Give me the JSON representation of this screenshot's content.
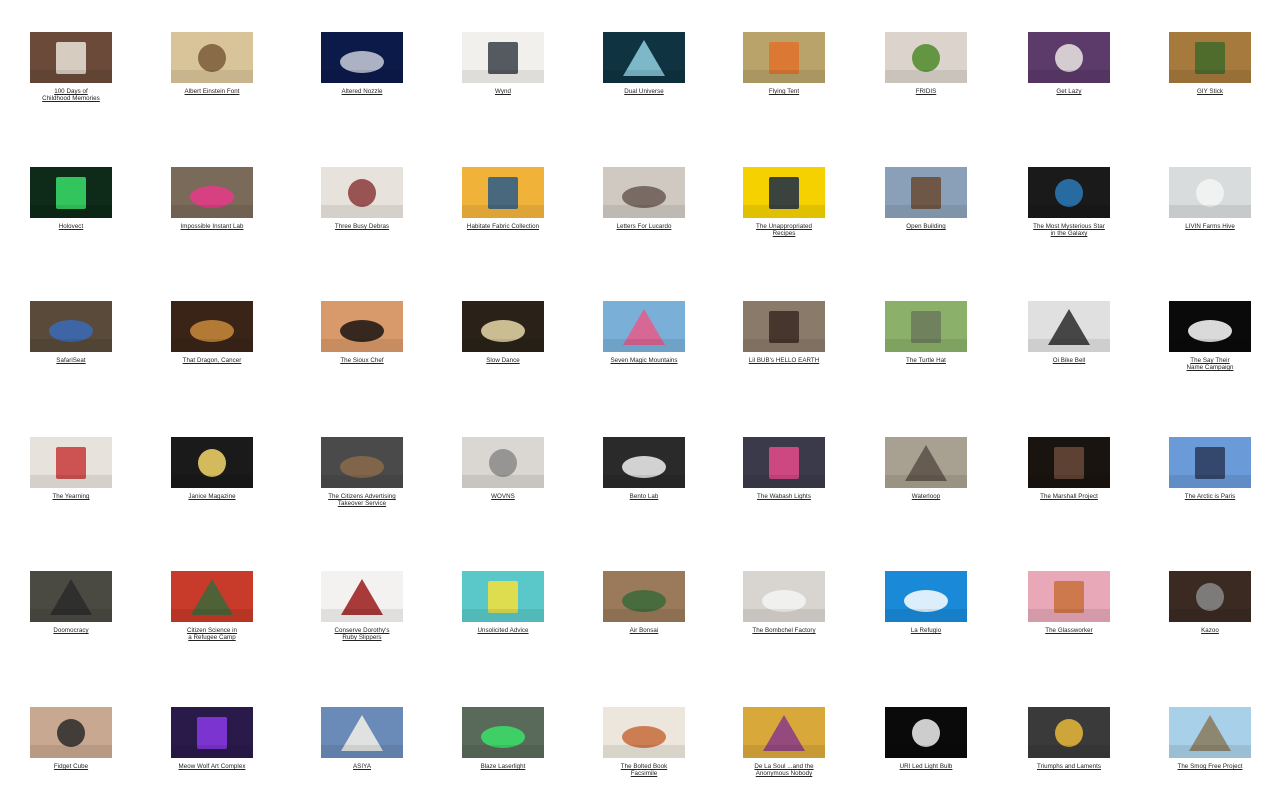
{
  "projects": [
    {
      "title": "100 Days of\nChildhood Memories",
      "bg": "#6b4a3a",
      "fg": "#e9e3d8",
      "icon": "memory-books-icon"
    },
    {
      "title": "Albert Einstein Font",
      "bg": "#d9c49a",
      "fg": "#7a5c38",
      "icon": "handwriting-icon"
    },
    {
      "title": "Altered Nozzle",
      "bg": "#0c1a4a",
      "fg": "#c9ced8",
      "icon": "faucet-icon"
    },
    {
      "title": "Wynd",
      "bg": "#f2f0ec",
      "fg": "#3a3f48",
      "icon": "air-purifier-icon"
    },
    {
      "title": "Dual Universe",
      "bg": "#0f3340",
      "fg": "#8fd0e0",
      "icon": "space-station-icon"
    },
    {
      "title": "Flying Tent",
      "bg": "#b9a36a",
      "fg": "#e0712a",
      "icon": "tent-icon"
    },
    {
      "title": "FRIDIS",
      "bg": "#dcd4cc",
      "fg": "#4f8a2a",
      "icon": "lime-figure-icon"
    },
    {
      "title": "Get Lazy",
      "bg": "#5c3a6a",
      "fg": "#e9e6e2",
      "icon": "phone-stand-icon"
    },
    {
      "title": "GIY Stick",
      "bg": "#a57a3c",
      "fg": "#3f6a2a",
      "icon": "potted-plant-icon"
    },
    {
      "title": "Holovect",
      "bg": "#0e2a18",
      "fg": "#39e06a",
      "icon": "hologram-icon"
    },
    {
      "title": "Impossible Instant Lab",
      "bg": "#7a6a5a",
      "fg": "#e73a8a",
      "icon": "instant-camera-icon"
    },
    {
      "title": "Three Busy Debras",
      "bg": "#e8e2dc",
      "fg": "#8a3a3a",
      "icon": "three-women-icon"
    },
    {
      "title": "Habitate Fabric Collection",
      "bg": "#f1b23a",
      "fg": "#2a5a8a",
      "icon": "geometric-fabric-icon"
    },
    {
      "title": "Letters For Lucardo",
      "bg": "#cfc9c2",
      "fg": "#6a5a52",
      "icon": "elderly-couple-icon"
    },
    {
      "title": "The Unappropriated\nRecipes",
      "bg": "#f5d100",
      "fg": "#1a2a4a",
      "icon": "cookbook-icon"
    },
    {
      "title": "Open Building",
      "bg": "#8aa0b8",
      "fg": "#6a4a32",
      "icon": "building-icon"
    },
    {
      "title": "The Most Mysterious Star\nin the Galaxy",
      "bg": "#1a1a1a",
      "fg": "#2a7ab8",
      "icon": "eye-icon"
    },
    {
      "title": "LIVIN Farms Hive",
      "bg": "#d8dcdc",
      "fg": "#f4f4f4",
      "icon": "hive-device-icon"
    },
    {
      "title": "SafariSeat",
      "bg": "#5a4a3a",
      "fg": "#3a6ab8",
      "icon": "wheelchair-icon"
    },
    {
      "title": "That Dragon, Cancer",
      "bg": "#3a2418",
      "fg": "#c88a3a",
      "icon": "game-scene-icon"
    },
    {
      "title": "The Sioux Chef",
      "bg": "#d89a6a",
      "fg": "#1a1410",
      "icon": "silhouette-icon"
    },
    {
      "title": "Slow Dance",
      "bg": "#2a2218",
      "fg": "#e8d8a8",
      "icon": "frame-lamp-icon"
    },
    {
      "title": "Seven Magic Mountains",
      "bg": "#7ab0d8",
      "fg": "#e85a8a",
      "icon": "stacked-rocks-icon"
    },
    {
      "title": "Lil BUB's HELLO EARTH",
      "bg": "#8a7a6a",
      "fg": "#3a2a22",
      "icon": "cat-face-icon"
    },
    {
      "title": "The Turtle Hat",
      "bg": "#8ab06a",
      "fg": "#6a7a5a",
      "icon": "knit-hat-icon"
    },
    {
      "title": "Oi Bike Bell",
      "bg": "#e0e0e0",
      "fg": "#2a2a2a",
      "icon": "bike-bell-icon"
    },
    {
      "title": "The Say Their\nName Campaign",
      "bg": "#0a0a0a",
      "fg": "#ffffff",
      "icon": "say-their-name-icon"
    },
    {
      "title": "The Yearning",
      "bg": "#e8e2dc",
      "fg": "#c83a3a",
      "icon": "illustration-icon"
    },
    {
      "title": "Janice Magazine",
      "bg": "#1a1a1a",
      "fg": "#f5d86a",
      "icon": "pop-art-icon"
    },
    {
      "title": "The Citizens Advertising\nTakeover Service",
      "bg": "#4a4a4a",
      "fg": "#8a6a4a",
      "icon": "subway-cat-icon"
    },
    {
      "title": "WOVNS",
      "bg": "#dad6d2",
      "fg": "#8a8a8a",
      "icon": "pattern-icon"
    },
    {
      "title": "Bento Lab",
      "bg": "#2a2a2a",
      "fg": "#f0f0f0",
      "icon": "lab-device-icon"
    },
    {
      "title": "The Wabash Lights",
      "bg": "#3a3a4a",
      "fg": "#e84a8a",
      "icon": "light-tunnel-icon"
    },
    {
      "title": "Waterloop",
      "bg": "#a8a090",
      "fg": "#5a5048",
      "icon": "cityscape-icon"
    },
    {
      "title": "The Marshall Project",
      "bg": "#1a1410",
      "fg": "#6a4a3a",
      "icon": "portrait-icon"
    },
    {
      "title": "The Arctic is Paris",
      "bg": "#6a9ad8",
      "fg": "#2a3a5a",
      "icon": "eiffel-tower-icon"
    },
    {
      "title": "Doomocracy",
      "bg": "#4a4a42",
      "fg": "#2a2a2a",
      "icon": "person-street-icon"
    },
    {
      "title": "Citizen Science in\na Refugee Camp",
      "bg": "#c83a2a",
      "fg": "#3a6a3a",
      "icon": "mural-icon"
    },
    {
      "title": "Conserve Dorothy's\nRuby Slippers",
      "bg": "#f4f2f0",
      "fg": "#9a1a1a",
      "icon": "ruby-slippers-icon"
    },
    {
      "title": "Unsolicited Advice",
      "bg": "#5ac8c8",
      "fg": "#f5e03a",
      "icon": "notebook-icon"
    },
    {
      "title": "Air Bonsai",
      "bg": "#9a7a5a",
      "fg": "#3a6a3a",
      "icon": "bonsai-icon"
    },
    {
      "title": "The Bombchel Factory",
      "bg": "#d8d4d0",
      "fg": "#f4f4f4",
      "icon": "tshirt-icon"
    },
    {
      "title": "La Refugio",
      "bg": "#1a8ad8",
      "fg": "#ffffff",
      "icon": "mascot-icon"
    },
    {
      "title": "The Glassworker",
      "bg": "#e8a8b8",
      "fg": "#c8703a",
      "icon": "anime-characters-icon"
    },
    {
      "title": "Kazoo",
      "bg": "#3a2a22",
      "fg": "#8a8a8a",
      "icon": "goggles-icon"
    },
    {
      "title": "Fidget Cube",
      "bg": "#c8a890",
      "fg": "#2a2a2a",
      "icon": "fidget-cube-icon"
    },
    {
      "title": "Meow Wolf Art Complex",
      "bg": "#2a1a4a",
      "fg": "#8a3ae8",
      "icon": "art-installation-icon"
    },
    {
      "title": "ASIYA",
      "bg": "#6a8ab8",
      "fg": "#f4f0e8",
      "icon": "two-women-icon"
    },
    {
      "title": "Blaze Laserlight",
      "bg": "#5a6a5a",
      "fg": "#39e06a",
      "icon": "bike-light-icon"
    },
    {
      "title": "The Bolted Book\nFacsimile",
      "bg": "#ece6dc",
      "fg": "#c86a3a",
      "icon": "exhibition-icon"
    },
    {
      "title": "De La Soul ...and the\nAnonymous Nobody",
      "bg": "#d8a83a",
      "fg": "#8a3a8a",
      "icon": "album-art-icon"
    },
    {
      "title": "URI Led Light Bulb",
      "bg": "#0a0a0a",
      "fg": "#f0f0f0",
      "icon": "light-bulbs-icon"
    },
    {
      "title": "Triumphs and Laments",
      "bg": "#3a3a3a",
      "fg": "#e8b83a",
      "icon": "yellow-line-icon"
    },
    {
      "title": "The Smog Free Project",
      "bg": "#a8d0e8",
      "fg": "#8a7a5a",
      "icon": "smog-ring-icon"
    }
  ]
}
